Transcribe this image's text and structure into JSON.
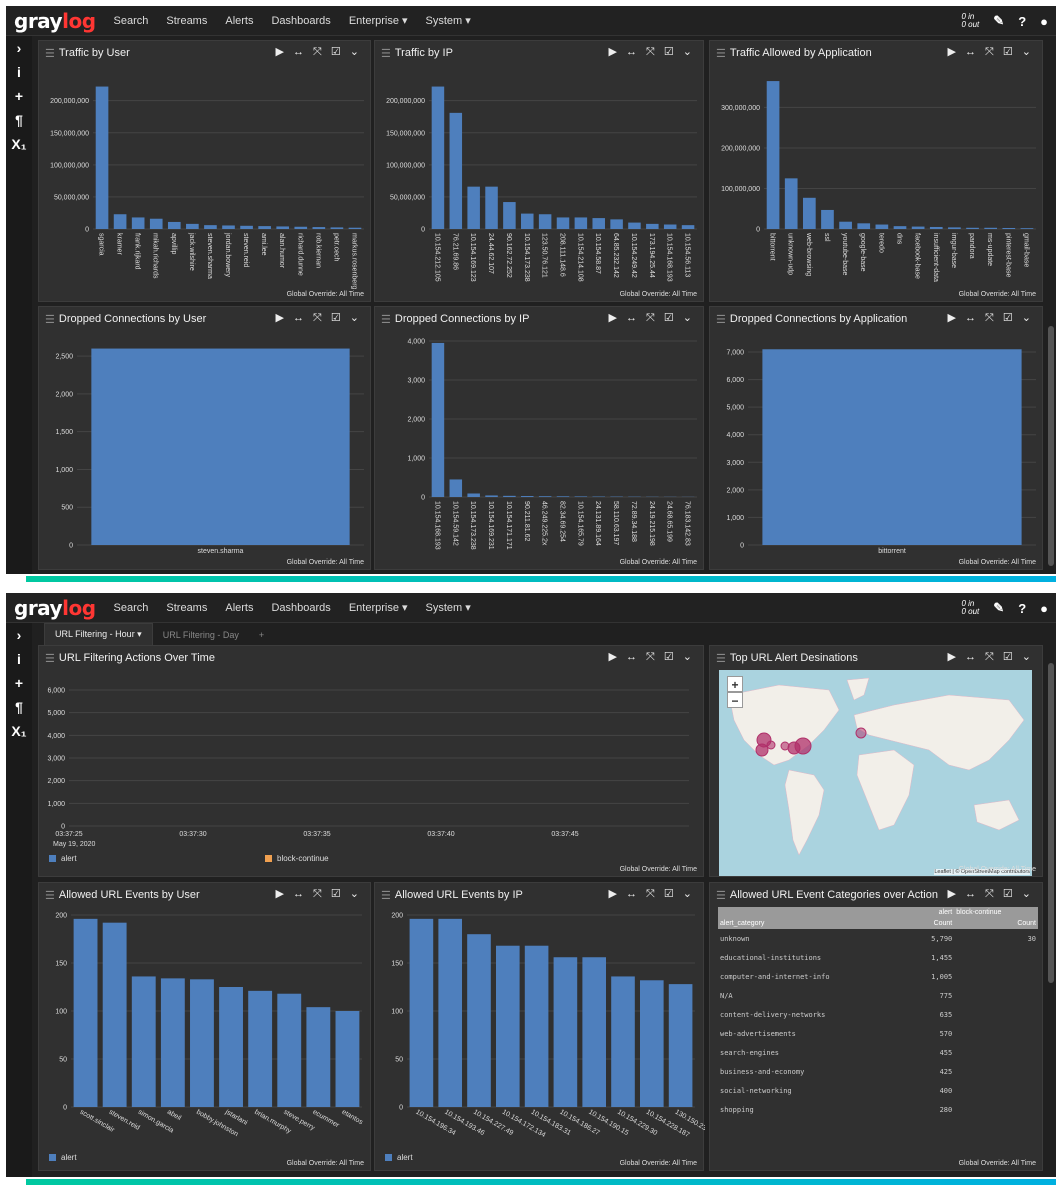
{
  "nav": {
    "logo_a": "gray",
    "logo_b": "log",
    "items": [
      "Search",
      "Streams",
      "Alerts",
      "Dashboards",
      "Enterprise ▾",
      "System ▾"
    ],
    "io_in": "0 in",
    "io_out": "0 out"
  },
  "sidebar": [
    "›",
    "i",
    "+",
    "¶",
    "X₁"
  ],
  "panel_controls": "▶ ↔ ⤧ ☑ ⌄",
  "override": "Global Override: All Time",
  "panels1": [
    {
      "title": "Traffic by User",
      "chart_data": {
        "type": "bar",
        "categories": [
          "sgarcia",
          "kramer",
          "frank.rijkard",
          "mikah.richards",
          "apvillip",
          "jack.wilshire",
          "steven.sharma",
          "jordan.bowery",
          "steven.reid",
          "ami.lee",
          "alan.humor",
          "richard.dunne",
          "rob.kiernan",
          "petr.cech",
          "markus.rosenberg"
        ],
        "values": [
          222000000,
          23000000,
          18000000,
          16000000,
          11000000,
          8000000,
          6000000,
          5500000,
          5000000,
          4500000,
          4000000,
          3500000,
          3000000,
          2500000,
          2000000
        ],
        "ylim": [
          0,
          240000000
        ],
        "yticks": [
          "0",
          "50,000,000",
          "100,000,000",
          "150,000,000",
          "200,000,000"
        ]
      }
    },
    {
      "title": "Traffic by IP",
      "chart_data": {
        "type": "bar",
        "categories": [
          "10.154.212.105",
          "76.21.69.86",
          "10.154.169.123",
          "24.44.62.107",
          "90.162.72.252",
          "10.154.173.238",
          "123.50.76.121",
          "208.111.148.6",
          "10.154.214.108",
          "10.154.58.87",
          "64.85.232.142",
          "10.154.249.42",
          "173.194.25.44",
          "10.154.168.193",
          "10.154.56.113"
        ],
        "values": [
          222000000,
          181000000,
          66000000,
          66000000,
          42000000,
          24000000,
          23000000,
          18000000,
          18000000,
          17000000,
          15000000,
          10000000,
          8000000,
          7000000,
          6000000
        ],
        "ylim": [
          0,
          240000000
        ],
        "yticks": [
          "0",
          "50,000,000",
          "100,000,000",
          "150,000,000",
          "200,000,000"
        ]
      }
    },
    {
      "title": "Traffic Allowed by Application",
      "chart_data": {
        "type": "bar",
        "categories": [
          "bittorrent",
          "unknown-udp",
          "web-browsing",
          "ssl",
          "youtube-base",
          "google-base",
          "teredo",
          "dns",
          "facebook-base",
          "insufficient-data",
          "imgur-base",
          "pandora",
          "ms-update",
          "pinterest-base",
          "gmail-base"
        ],
        "values": [
          365000000,
          125000000,
          77000000,
          47000000,
          18000000,
          14000000,
          11000000,
          7000000,
          6000000,
          5000000,
          4000000,
          3000000,
          3000000,
          2500000,
          2000000
        ],
        "ylim": [
          0,
          380000000
        ],
        "yticks": [
          "0",
          "100,000,000",
          "200,000,000",
          "300,000,000"
        ]
      }
    },
    {
      "title": "Dropped Connections by User",
      "chart_data": {
        "type": "bar",
        "categories": [
          "steven.sharma"
        ],
        "values": [
          2600
        ],
        "ylim": [
          0,
          2700
        ],
        "yticks": [
          "0",
          "500",
          "1,000",
          "1,500",
          "2,000",
          "2,500"
        ]
      }
    },
    {
      "title": "Dropped Connections by IP",
      "chart_data": {
        "type": "bar",
        "categories": [
          "10.154.168.193",
          "10.154.59.142",
          "10.154.173.238",
          "10.154.169.231",
          "10.154.171.171",
          "90.211.81.62",
          "46.249.225.2x",
          "82.34.69.254",
          "10.154.165.79",
          "24.131.89.164",
          "58.110.63.197",
          "72.89.34.188",
          "24.19.215.198",
          "24.68.65.199",
          "76.183.142.83"
        ],
        "values": [
          3950,
          450,
          90,
          40,
          30,
          25,
          20,
          18,
          15,
          12,
          10,
          8,
          6,
          5,
          4
        ],
        "ylim": [
          0,
          4000
        ],
        "yticks": [
          "0",
          "1,000",
          "2,000",
          "3,000",
          "4,000"
        ]
      }
    },
    {
      "title": "Dropped Connections by Application",
      "chart_data": {
        "type": "bar",
        "categories": [
          "bittorrent"
        ],
        "values": [
          7100
        ],
        "ylim": [
          0,
          7400
        ],
        "yticks": [
          "0",
          "1,000",
          "2,000",
          "3,000",
          "4,000",
          "5,000",
          "6,000",
          "7,000"
        ]
      }
    }
  ],
  "tabs": [
    "URL Filtering - Hour ▾",
    "URL Filtering - Day",
    "+"
  ],
  "line_panel": {
    "title": "URL Filtering Actions Over Time",
    "chart_data": {
      "type": "line",
      "x": [
        "03:37:25",
        "03:37:30",
        "03:37:35",
        "03:37:40",
        "03:37:45"
      ],
      "date_label": "May 19, 2020",
      "yticks": [
        "0",
        "1,000",
        "2,000",
        "3,000",
        "4,000",
        "5,000",
        "6,000"
      ],
      "series": [
        {
          "name": "alert",
          "color": "#4e7fbd",
          "values": []
        },
        {
          "name": "block-continue",
          "color": "#f0a050",
          "values": []
        }
      ]
    }
  },
  "map_panel": {
    "title": "Top URL Alert Desinations",
    "zoom_in": "+",
    "zoom_out": "−",
    "attribution": "Leaflet | © OpenStreetMap contributors"
  },
  "user_panel": {
    "title": "Allowed URL Events by User",
    "legend": "alert",
    "chart_data": {
      "type": "bar",
      "categories": [
        "scott.sinclair",
        "steven.reid",
        "simon.garcia",
        "abeil",
        "bobby.johnston",
        "jstarlani",
        "brian.murphy",
        "steve.perry",
        "ecummer",
        "etantos"
      ],
      "values": [
        196,
        192,
        136,
        134,
        133,
        125,
        121,
        118,
        104,
        100
      ],
      "ylim": [
        0,
        200
      ],
      "yticks": [
        "0",
        "50",
        "100",
        "150",
        "200"
      ]
    }
  },
  "ip_panel": {
    "title": "Allowed URL Events by IP",
    "legend": "alert",
    "chart_data": {
      "type": "bar",
      "categories": [
        "10.154.196.34",
        "10.154.193.46",
        "10.154.227.49",
        "10.154.172.134",
        "10.154.183.31",
        "10.154.186.27",
        "10.154.190.15",
        "10.154.229.30",
        "10.154.228.187",
        "130.150.237.6"
      ],
      "values": [
        196,
        196,
        180,
        168,
        168,
        156,
        156,
        136,
        132,
        128
      ],
      "ylim": [
        0,
        200
      ],
      "yticks": [
        "0",
        "50",
        "100",
        "150",
        "200"
      ]
    }
  },
  "table_panel": {
    "title": "Allowed URL Event Categories over Action",
    "group_headers": [
      "alert",
      "block-continue"
    ],
    "columns": [
      "alert_category",
      "Count",
      "Count"
    ],
    "rows": [
      [
        "unknown",
        "5,790",
        "30"
      ],
      [
        "educational-institutions",
        "1,455",
        ""
      ],
      [
        "computer-and-internet-info",
        "1,005",
        ""
      ],
      [
        "N/A",
        "775",
        ""
      ],
      [
        "content-delivery-networks",
        "635",
        ""
      ],
      [
        "web-advertisements",
        "570",
        ""
      ],
      [
        "search-engines",
        "455",
        ""
      ],
      [
        "business-and-economy",
        "425",
        ""
      ],
      [
        "social-networking",
        "400",
        ""
      ],
      [
        "shopping",
        "280",
        ""
      ]
    ]
  }
}
